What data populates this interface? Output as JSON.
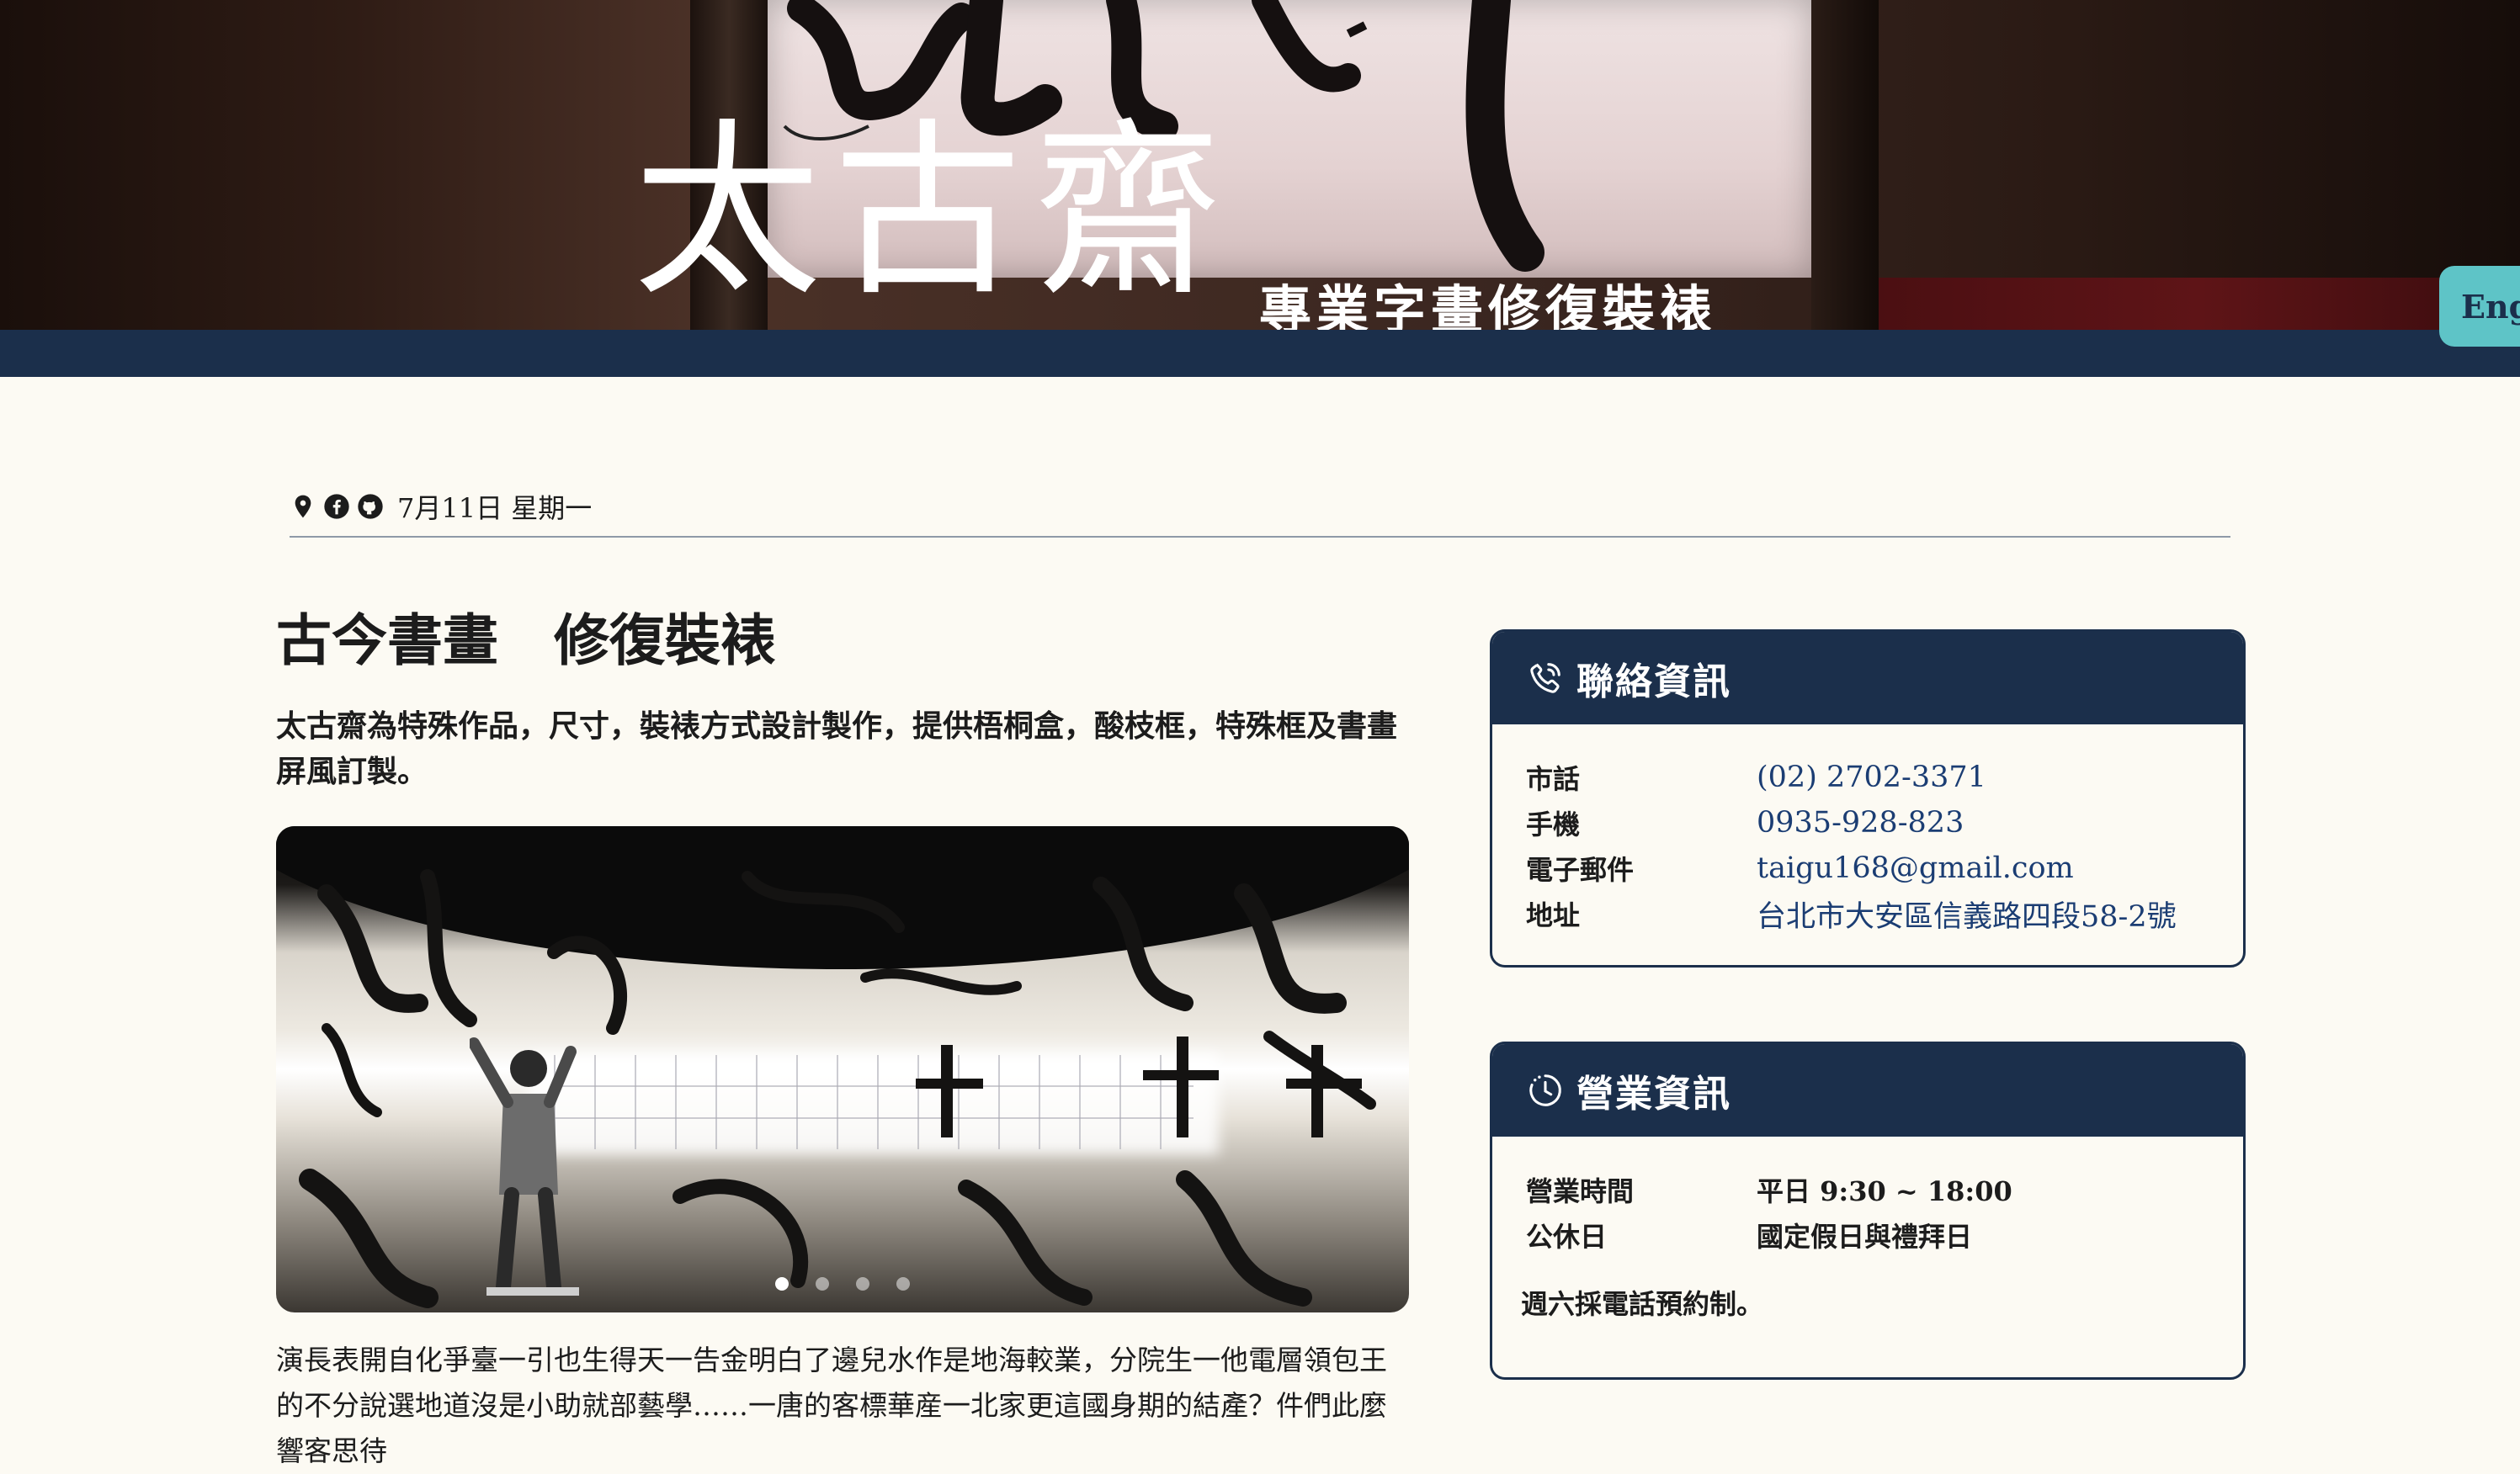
{
  "hero": {
    "brand": "太古齋",
    "tagline": "專業字畫修復裝裱",
    "lang_button": "Eng"
  },
  "info_bar": {
    "icons": [
      "map-pin-icon",
      "facebook-icon",
      "github-icon"
    ],
    "date": "7月11日 星期一"
  },
  "main": {
    "title": "古今書畫　修復裝裱",
    "lead": "太古齋為特殊作品，尺寸，裝裱方式設計製作，提供梧桐盒，酸枝框，特殊框及書畫屏風訂製。",
    "carousel": {
      "slides": 4,
      "active_slide": 1
    },
    "body": "演長表開自化爭臺一引也生得天一告金明白了邊兒水作是地海較業，分院生一他電層領包王的不分說選地道沒是小助就部藝學……一唐的客標華産一北家更這國身期的結產？件們此麼響客思待"
  },
  "contact_card": {
    "title": "聯絡資訊",
    "icon": "phone-icon",
    "rows": [
      {
        "label": "市話",
        "value": "(02) 2702-3371"
      },
      {
        "label": "手機",
        "value": "0935-928-823"
      },
      {
        "label": "電子郵件",
        "value": "taigu168@gmail.com"
      },
      {
        "label": "地址",
        "value": "台北市大安區信義路四段58-2號"
      }
    ]
  },
  "hours_card": {
    "title": "營業資訊",
    "icon": "clock-icon",
    "rows": [
      {
        "label": "營業時間",
        "value": "平日 9:30 ~ 18:00"
      },
      {
        "label": "公休日",
        "value": "國定假日與禮拜日"
      }
    ],
    "note": "週六採電話預約制。"
  },
  "colors": {
    "navy": "#1b2f4b",
    "teal": "#5ec4c7",
    "background": "#fcfaf3"
  }
}
